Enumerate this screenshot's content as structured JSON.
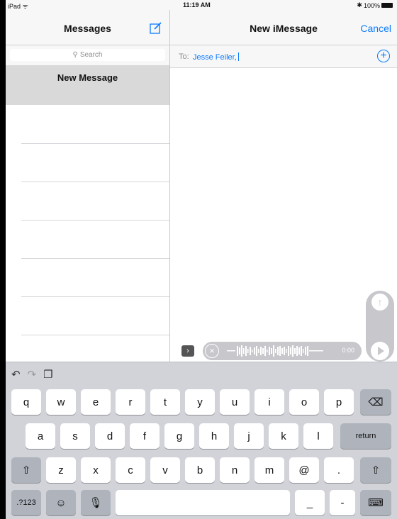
{
  "status_bar": {
    "carrier": "iPad",
    "time": "11:19 AM",
    "battery": "100%"
  },
  "messages_pane": {
    "title": "Messages",
    "search_placeholder": "Search",
    "new_message_label": "New Message"
  },
  "compose_pane": {
    "title": "New iMessage",
    "cancel_label": "Cancel",
    "to_label": "To:",
    "recipient": "Jesse Feiler,",
    "audio_time": "0:00"
  },
  "keyboard": {
    "row1": [
      "q",
      "w",
      "e",
      "r",
      "t",
      "y",
      "u",
      "i",
      "o",
      "p"
    ],
    "row2": [
      "a",
      "s",
      "d",
      "f",
      "g",
      "h",
      "j",
      "k",
      "l"
    ],
    "return_label": "return",
    "row3": [
      "z",
      "x",
      "c",
      "v",
      "b",
      "n",
      "m",
      "@",
      "."
    ],
    "numbers_label": ".?123",
    "underscore_label": "_",
    "dash_label": "-"
  },
  "colors": {
    "accent": "#0a7aff",
    "keyboard_bg": "#d1d3d9"
  }
}
